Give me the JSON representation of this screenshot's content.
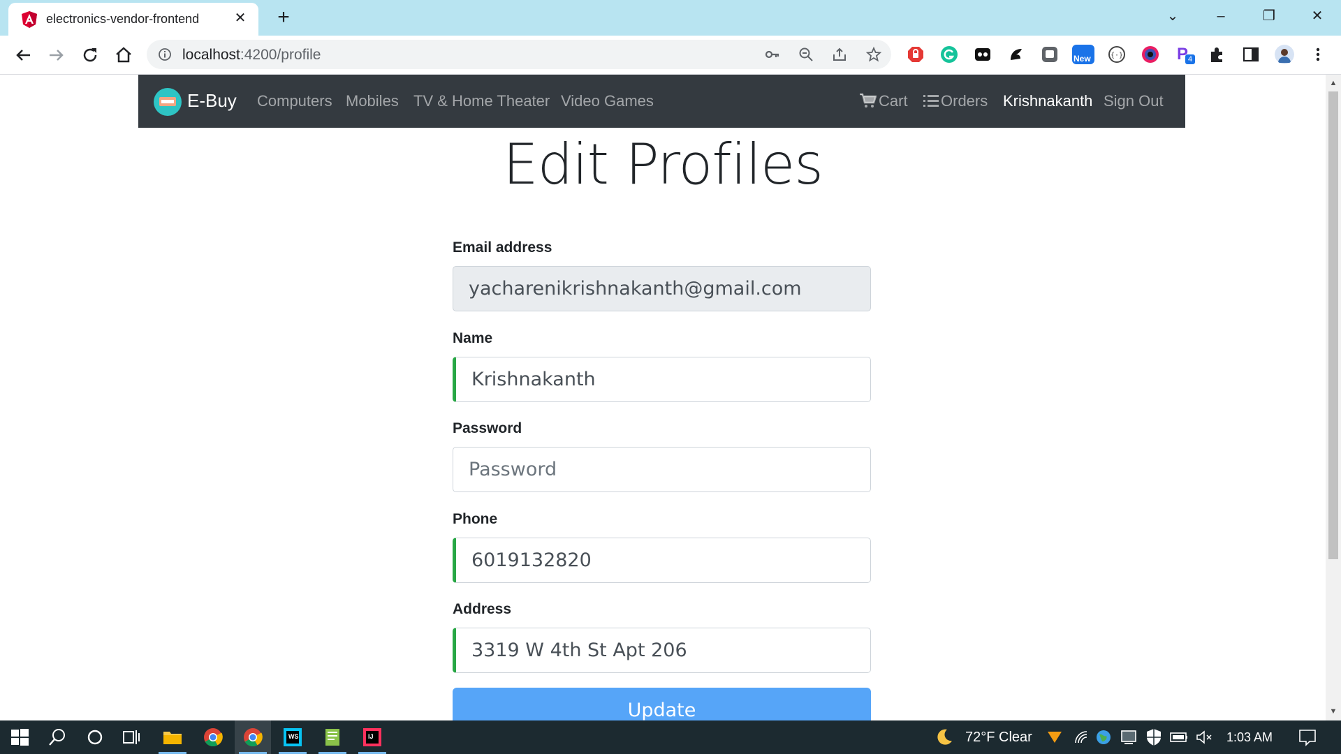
{
  "browser": {
    "tab_title": "electronics-vendor-frontend",
    "url_host": "localhost",
    "url_path": ":4200/profile",
    "extension_badge_new": "New",
    "extension_badge_count": "4"
  },
  "navbar": {
    "brand": "E-Buy",
    "links": [
      "Computers",
      "Mobiles",
      "TV & Home Theater",
      "Video Games"
    ],
    "cart": "Cart",
    "orders": "Orders",
    "user": "Krishnakanth",
    "signout": "Sign Out"
  },
  "form": {
    "title": "Edit Profiles",
    "email_label": "Email address",
    "email_value": "yacharenikrishnakanth@gmail.com",
    "name_label": "Name",
    "name_value": "Krishnakanth",
    "password_label": "Password",
    "password_placeholder": "Password",
    "phone_label": "Phone",
    "phone_value": "6019132820",
    "address_label": "Address",
    "address_value": "3319 W 4th St Apt 206",
    "submit_label": "Update"
  },
  "taskbar": {
    "weather": "72°F  Clear",
    "time": "1:03 AM"
  },
  "colors": {
    "navbar_bg": "#343a40",
    "valid_border": "#28a745",
    "button_bg": "#56a5f8",
    "tabstrip_bg": "#b8e4f1",
    "taskbar_bg": "#1c2a30"
  }
}
